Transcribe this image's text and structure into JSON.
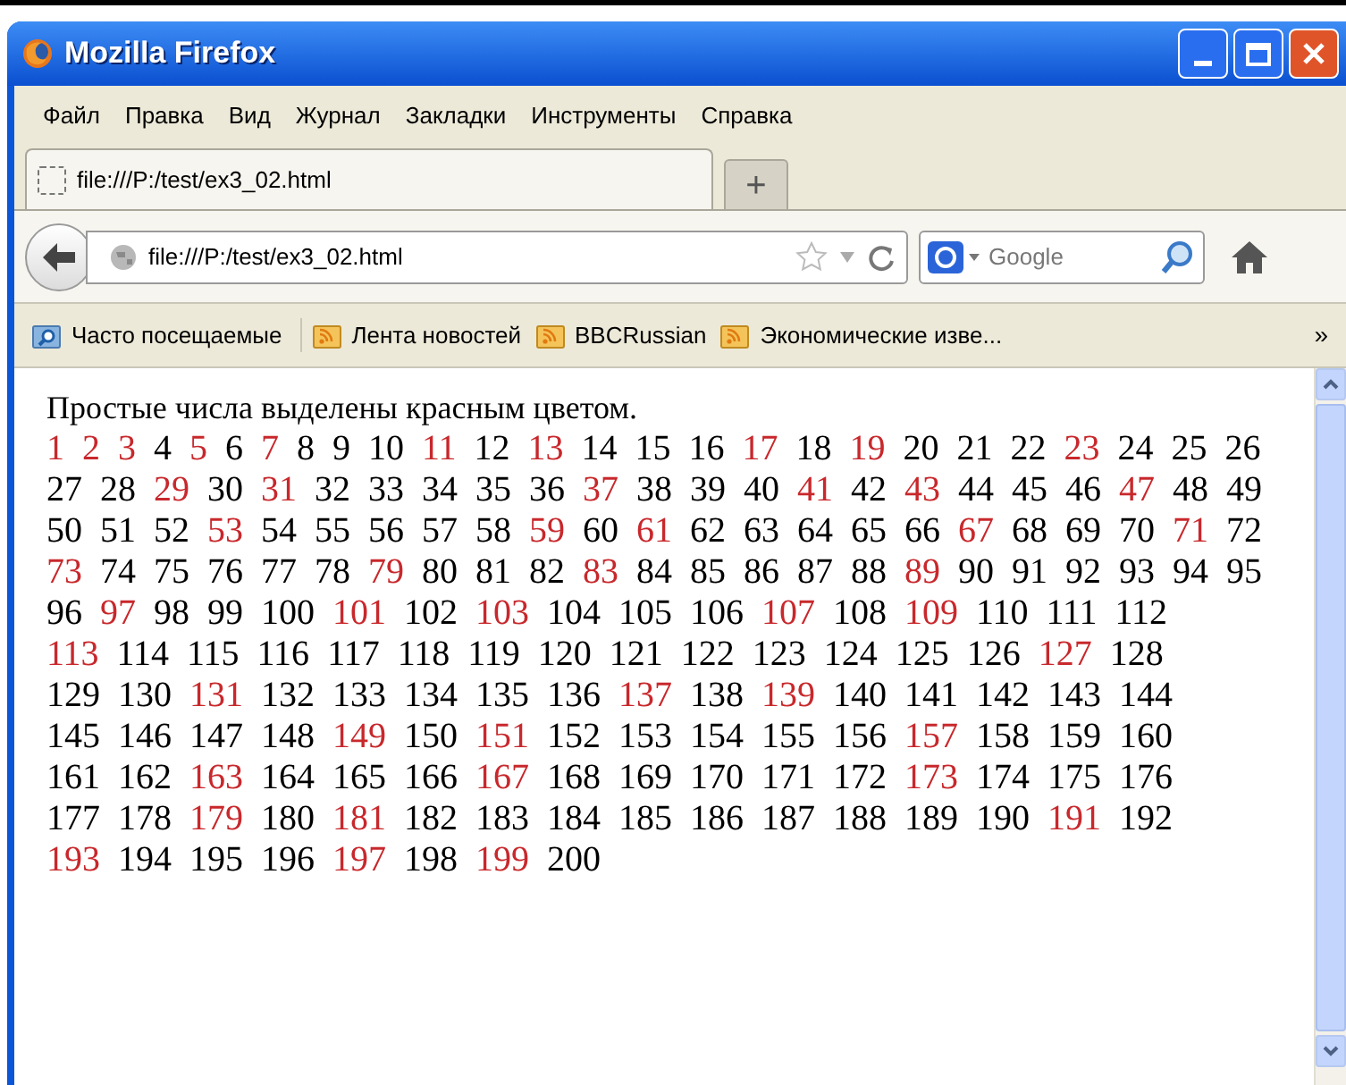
{
  "window": {
    "title": "Mozilla Firefox"
  },
  "menu": [
    "Файл",
    "Правка",
    "Вид",
    "Журнал",
    "Закладки",
    "Инструменты",
    "Справка"
  ],
  "tabs": [
    {
      "label": "file:///P:/test/ex3_02.html",
      "selected": true
    }
  ],
  "new_tab": "+",
  "address": {
    "value": "file:///P:/test/ex3_02.html"
  },
  "search": {
    "placeholder": "Google"
  },
  "bookmarks": [
    {
      "label": "Часто посещаемые",
      "kind": "smart"
    },
    {
      "label": "Лента новостей",
      "kind": "feed"
    },
    {
      "label": "BBCRussian",
      "kind": "feed"
    },
    {
      "label": "Экономические изве...",
      "kind": "feed"
    }
  ],
  "bookmarks_more": "»",
  "page": {
    "heading": "Простые числа выделены красным цветом.",
    "lines": [
      [
        {
          "text": "1",
          "highlighted": true
        },
        {
          "text": "2",
          "highlighted": true
        },
        {
          "text": "3",
          "highlighted": true
        },
        {
          "text": "4",
          "highlighted": false
        },
        {
          "text": "5",
          "highlighted": true
        },
        {
          "text": "6",
          "highlighted": false
        },
        {
          "text": "7",
          "highlighted": true
        },
        {
          "text": "8",
          "highlighted": false
        },
        {
          "text": "9",
          "highlighted": false
        },
        {
          "text": "10",
          "highlighted": false
        },
        {
          "text": "11",
          "highlighted": true
        },
        {
          "text": "12",
          "highlighted": false
        },
        {
          "text": "13",
          "highlighted": true
        },
        {
          "text": "14",
          "highlighted": false
        },
        {
          "text": "15",
          "highlighted": false
        },
        {
          "text": "16",
          "highlighted": false
        },
        {
          "text": "17",
          "highlighted": true
        },
        {
          "text": "18",
          "highlighted": false
        },
        {
          "text": "19",
          "highlighted": true
        },
        {
          "text": "20",
          "highlighted": false
        },
        {
          "text": "21",
          "highlighted": false
        },
        {
          "text": "22",
          "highlighted": false
        },
        {
          "text": "23",
          "highlighted": true
        },
        {
          "text": "24",
          "highlighted": false
        },
        {
          "text": "25",
          "highlighted": false
        },
        {
          "text": "26",
          "highlighted": false
        }
      ],
      [
        {
          "text": "27",
          "highlighted": false
        },
        {
          "text": "28",
          "highlighted": false
        },
        {
          "text": "29",
          "highlighted": true
        },
        {
          "text": "30",
          "highlighted": false
        },
        {
          "text": "31",
          "highlighted": true
        },
        {
          "text": "32",
          "highlighted": false
        },
        {
          "text": "33",
          "highlighted": false
        },
        {
          "text": "34",
          "highlighted": false
        },
        {
          "text": "35",
          "highlighted": false
        },
        {
          "text": "36",
          "highlighted": false
        },
        {
          "text": "37",
          "highlighted": true
        },
        {
          "text": "38",
          "highlighted": false
        },
        {
          "text": "39",
          "highlighted": false
        },
        {
          "text": "40",
          "highlighted": false
        },
        {
          "text": "41",
          "highlighted": true
        },
        {
          "text": "42",
          "highlighted": false
        },
        {
          "text": "43",
          "highlighted": true
        },
        {
          "text": "44",
          "highlighted": false
        },
        {
          "text": "45",
          "highlighted": false
        },
        {
          "text": "46",
          "highlighted": false
        },
        {
          "text": "47",
          "highlighted": true
        },
        {
          "text": "48",
          "highlighted": false
        },
        {
          "text": "49",
          "highlighted": false
        }
      ],
      [
        {
          "text": "50",
          "highlighted": false
        },
        {
          "text": "51",
          "highlighted": false
        },
        {
          "text": "52",
          "highlighted": false
        },
        {
          "text": "53",
          "highlighted": true
        },
        {
          "text": "54",
          "highlighted": false
        },
        {
          "text": "55",
          "highlighted": false
        },
        {
          "text": "56",
          "highlighted": false
        },
        {
          "text": "57",
          "highlighted": false
        },
        {
          "text": "58",
          "highlighted": false
        },
        {
          "text": "59",
          "highlighted": true
        },
        {
          "text": "60",
          "highlighted": false
        },
        {
          "text": "61",
          "highlighted": true
        },
        {
          "text": "62",
          "highlighted": false
        },
        {
          "text": "63",
          "highlighted": false
        },
        {
          "text": "64",
          "highlighted": false
        },
        {
          "text": "65",
          "highlighted": false
        },
        {
          "text": "66",
          "highlighted": false
        },
        {
          "text": "67",
          "highlighted": true
        },
        {
          "text": "68",
          "highlighted": false
        },
        {
          "text": "69",
          "highlighted": false
        },
        {
          "text": "70",
          "highlighted": false
        },
        {
          "text": "71",
          "highlighted": true
        },
        {
          "text": "72",
          "highlighted": false
        }
      ],
      [
        {
          "text": "73",
          "highlighted": true
        },
        {
          "text": "74",
          "highlighted": false
        },
        {
          "text": "75",
          "highlighted": false
        },
        {
          "text": "76",
          "highlighted": false
        },
        {
          "text": "77",
          "highlighted": false
        },
        {
          "text": "78",
          "highlighted": false
        },
        {
          "text": "79",
          "highlighted": true
        },
        {
          "text": "80",
          "highlighted": false
        },
        {
          "text": "81",
          "highlighted": false
        },
        {
          "text": "82",
          "highlighted": false
        },
        {
          "text": "83",
          "highlighted": true
        },
        {
          "text": "84",
          "highlighted": false
        },
        {
          "text": "85",
          "highlighted": false
        },
        {
          "text": "86",
          "highlighted": false
        },
        {
          "text": "87",
          "highlighted": false
        },
        {
          "text": "88",
          "highlighted": false
        },
        {
          "text": "89",
          "highlighted": true
        },
        {
          "text": "90",
          "highlighted": false
        },
        {
          "text": "91",
          "highlighted": false
        },
        {
          "text": "92",
          "highlighted": false
        },
        {
          "text": "93",
          "highlighted": false
        },
        {
          "text": "94",
          "highlighted": false
        },
        {
          "text": "95",
          "highlighted": false
        }
      ],
      [
        {
          "text": "96",
          "highlighted": false
        },
        {
          "text": "97",
          "highlighted": true
        },
        {
          "text": "98",
          "highlighted": false
        },
        {
          "text": "99",
          "highlighted": false
        },
        {
          "text": "100",
          "highlighted": false
        },
        {
          "text": "101",
          "highlighted": true
        },
        {
          "text": "102",
          "highlighted": false
        },
        {
          "text": "103",
          "highlighted": true
        },
        {
          "text": "104",
          "highlighted": false
        },
        {
          "text": "105",
          "highlighted": false
        },
        {
          "text": "106",
          "highlighted": false
        },
        {
          "text": "107",
          "highlighted": true
        },
        {
          "text": "108",
          "highlighted": false
        },
        {
          "text": "109",
          "highlighted": true
        },
        {
          "text": "110",
          "highlighted": false
        },
        {
          "text": "111",
          "highlighted": false
        },
        {
          "text": "112",
          "highlighted": false
        }
      ],
      [
        {
          "text": "113",
          "highlighted": true
        },
        {
          "text": "114",
          "highlighted": false
        },
        {
          "text": "115",
          "highlighted": false
        },
        {
          "text": "116",
          "highlighted": false
        },
        {
          "text": "117",
          "highlighted": false
        },
        {
          "text": "118",
          "highlighted": false
        },
        {
          "text": "119",
          "highlighted": false
        },
        {
          "text": "120",
          "highlighted": false
        },
        {
          "text": "121",
          "highlighted": false
        },
        {
          "text": "122",
          "highlighted": false
        },
        {
          "text": "123",
          "highlighted": false
        },
        {
          "text": "124",
          "highlighted": false
        },
        {
          "text": "125",
          "highlighted": false
        },
        {
          "text": "126",
          "highlighted": false
        },
        {
          "text": "127",
          "highlighted": true
        },
        {
          "text": "128",
          "highlighted": false
        }
      ],
      [
        {
          "text": "129",
          "highlighted": false
        },
        {
          "text": "130",
          "highlighted": false
        },
        {
          "text": "131",
          "highlighted": true
        },
        {
          "text": "132",
          "highlighted": false
        },
        {
          "text": "133",
          "highlighted": false
        },
        {
          "text": "134",
          "highlighted": false
        },
        {
          "text": "135",
          "highlighted": false
        },
        {
          "text": "136",
          "highlighted": false
        },
        {
          "text": "137",
          "highlighted": true
        },
        {
          "text": "138",
          "highlighted": false
        },
        {
          "text": "139",
          "highlighted": true
        },
        {
          "text": "140",
          "highlighted": false
        },
        {
          "text": "141",
          "highlighted": false
        },
        {
          "text": "142",
          "highlighted": false
        },
        {
          "text": "143",
          "highlighted": false
        },
        {
          "text": "144",
          "highlighted": false
        }
      ],
      [
        {
          "text": "145",
          "highlighted": false
        },
        {
          "text": "146",
          "highlighted": false
        },
        {
          "text": "147",
          "highlighted": false
        },
        {
          "text": "148",
          "highlighted": false
        },
        {
          "text": "149",
          "highlighted": true
        },
        {
          "text": "150",
          "highlighted": false
        },
        {
          "text": "151",
          "highlighted": true
        },
        {
          "text": "152",
          "highlighted": false
        },
        {
          "text": "153",
          "highlighted": false
        },
        {
          "text": "154",
          "highlighted": false
        },
        {
          "text": "155",
          "highlighted": false
        },
        {
          "text": "156",
          "highlighted": false
        },
        {
          "text": "157",
          "highlighted": true
        },
        {
          "text": "158",
          "highlighted": false
        },
        {
          "text": "159",
          "highlighted": false
        },
        {
          "text": "160",
          "highlighted": false
        }
      ],
      [
        {
          "text": "161",
          "highlighted": false
        },
        {
          "text": "162",
          "highlighted": false
        },
        {
          "text": "163",
          "highlighted": true
        },
        {
          "text": "164",
          "highlighted": false
        },
        {
          "text": "165",
          "highlighted": false
        },
        {
          "text": "166",
          "highlighted": false
        },
        {
          "text": "167",
          "highlighted": true
        },
        {
          "text": "168",
          "highlighted": false
        },
        {
          "text": "169",
          "highlighted": false
        },
        {
          "text": "170",
          "highlighted": false
        },
        {
          "text": "171",
          "highlighted": false
        },
        {
          "text": "172",
          "highlighted": false
        },
        {
          "text": "173",
          "highlighted": true
        },
        {
          "text": "174",
          "highlighted": false
        },
        {
          "text": "175",
          "highlighted": false
        },
        {
          "text": "176",
          "highlighted": false
        }
      ],
      [
        {
          "text": "177",
          "highlighted": false
        },
        {
          "text": "178",
          "highlighted": false
        },
        {
          "text": "179",
          "highlighted": true
        },
        {
          "text": "180",
          "highlighted": false
        },
        {
          "text": "181",
          "highlighted": true
        },
        {
          "text": "182",
          "highlighted": false
        },
        {
          "text": "183",
          "highlighted": false
        },
        {
          "text": "184",
          "highlighted": false
        },
        {
          "text": "185",
          "highlighted": false
        },
        {
          "text": "186",
          "highlighted": false
        },
        {
          "text": "187",
          "highlighted": false
        },
        {
          "text": "188",
          "highlighted": false
        },
        {
          "text": "189",
          "highlighted": false
        },
        {
          "text": "190",
          "highlighted": false
        },
        {
          "text": "191",
          "highlighted": true
        },
        {
          "text": "192",
          "highlighted": false
        }
      ],
      [
        {
          "text": "193",
          "highlighted": true
        },
        {
          "text": "194",
          "highlighted": false
        },
        {
          "text": "195",
          "highlighted": false
        },
        {
          "text": "196",
          "highlighted": false
        },
        {
          "text": "197",
          "highlighted": true
        },
        {
          "text": "198",
          "highlighted": false
        },
        {
          "text": "199",
          "highlighted": true
        },
        {
          "text": "200",
          "highlighted": false
        }
      ]
    ]
  }
}
